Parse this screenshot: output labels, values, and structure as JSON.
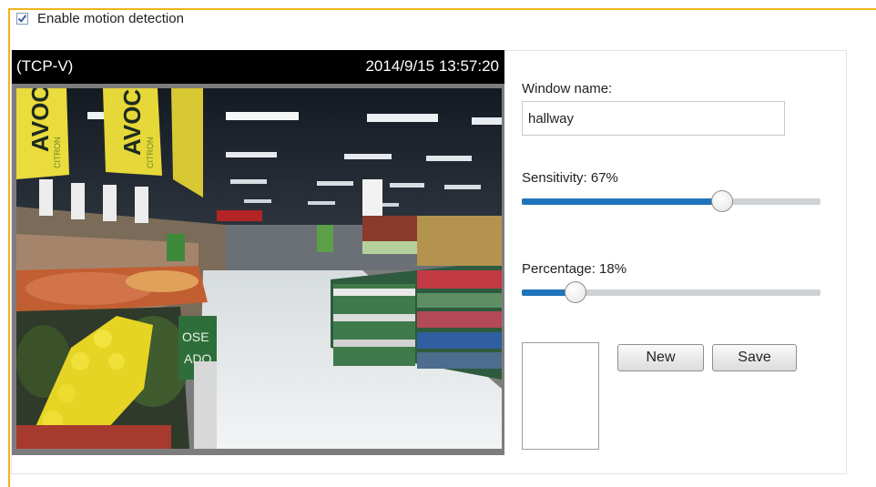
{
  "motion": {
    "enable_label": "Enable motion detection",
    "enabled": true
  },
  "video": {
    "stream_label": "(TCP-V)",
    "timestamp": "2014/9/15 13:57:20",
    "scene": "supermarket-aisle-camera-feed",
    "banner_text": [
      "AVOC",
      "AVOC"
    ],
    "banner_subtext": [
      "CITRON",
      "CITRON"
    ],
    "sign_text": [
      "OSE",
      "ADO"
    ]
  },
  "settings": {
    "window_name_label": "Window name:",
    "window_name_value": "hallway",
    "sensitivity_label": "Sensitivity: 67%",
    "sensitivity_value": 67,
    "percentage_label": "Percentage: 18%",
    "percentage_value": 18
  },
  "buttons": {
    "new_label": "New",
    "save_label": "Save"
  },
  "colors": {
    "frame_accent": "#f0b41c",
    "slider_fill": "#1f74bb",
    "slider_track": "#cfd2d5"
  }
}
